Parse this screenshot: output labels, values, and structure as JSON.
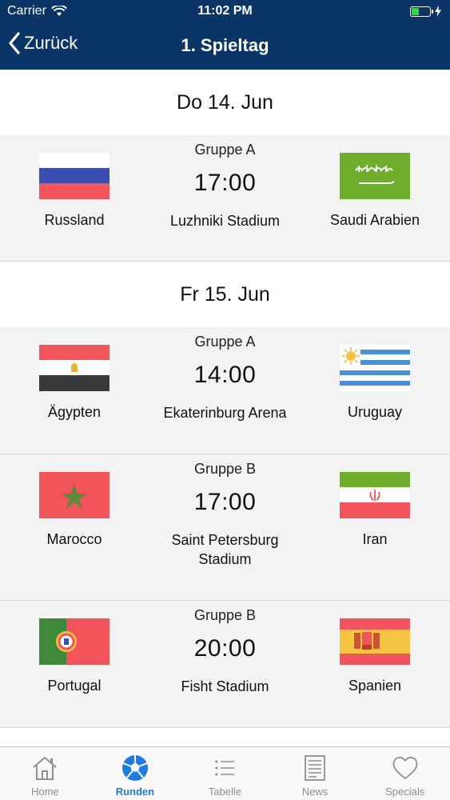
{
  "status_bar": {
    "carrier": "Carrier",
    "time": "11:02 PM"
  },
  "navbar": {
    "back_label": "Zurück",
    "title": "1. Spieltag"
  },
  "colors": {
    "header": "#0b3566",
    "accent": "#1f7be0",
    "row_bg": "#f3f3f4"
  },
  "days": [
    {
      "label": "Do 14. Jun",
      "matches": [
        {
          "group": "Gruppe A",
          "time": "17:00",
          "stadium": "Luzhniki Stadium",
          "home": "Russland",
          "away": "Saudi Arabien",
          "home_flag": "russia-flag-icon",
          "away_flag": "saudi-arabia-flag-icon"
        }
      ]
    },
    {
      "label": "Fr 15. Jun",
      "matches": [
        {
          "group": "Gruppe A",
          "time": "14:00",
          "stadium": "Ekaterinburg Arena",
          "home": "Ägypten",
          "away": "Uruguay",
          "home_flag": "egypt-flag-icon",
          "away_flag": "uruguay-flag-icon"
        },
        {
          "group": "Gruppe B",
          "time": "17:00",
          "stadium": "Saint Petersburg Stadium",
          "home": "Marocco",
          "away": "Iran",
          "home_flag": "morocco-flag-icon",
          "away_flag": "iran-flag-icon"
        },
        {
          "group": "Gruppe B",
          "time": "20:00",
          "stadium": "Fisht Stadium",
          "home": "Portugal",
          "away": "Spanien",
          "home_flag": "portugal-flag-icon",
          "away_flag": "spain-flag-icon"
        }
      ]
    }
  ],
  "tabs": [
    {
      "label": "Home",
      "icon": "house-icon"
    },
    {
      "label": "Runden",
      "icon": "soccer-ball-icon",
      "active": true
    },
    {
      "label": "Tabelle",
      "icon": "list-icon"
    },
    {
      "label": "News",
      "icon": "newspaper-icon"
    },
    {
      "label": "Specials",
      "icon": "heart-icon"
    }
  ]
}
